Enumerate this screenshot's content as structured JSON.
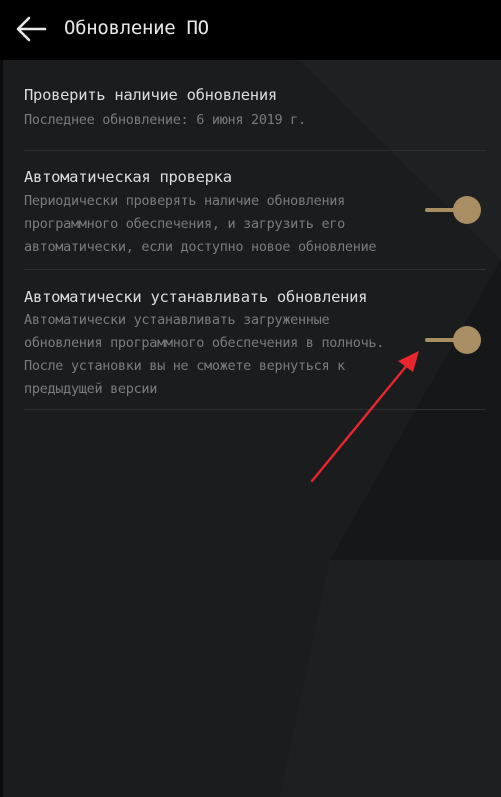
{
  "appbar": {
    "title": "Обновление ПО"
  },
  "settings": [
    {
      "title": "Проверить наличие обновления",
      "subtitle_lines": [
        "Последнее обновление: 6 июня 2019 г."
      ]
    },
    {
      "title": "Автоматическая проверка",
      "subtitle_lines": [
        "Периодически проверять наличие обновления",
        "программного обеспечения, и загрузить его",
        "автоматически, если доступно новое обновление"
      ],
      "toggle_on": true
    },
    {
      "title": "Автоматически устанавливать обновления",
      "subtitle_lines": [
        "Автоматически устанавливать загруженные",
        "обновления программного обеспечения в полночь.",
        "После установки вы не сможете вернуться к",
        "предыдущей версии"
      ],
      "toggle_on": true
    }
  ],
  "colors": {
    "accent": "#a88e62",
    "annotation_arrow": "#e8262d",
    "appbar_bg": "#000000",
    "page_bg": "#1b1c1e"
  },
  "icons": {
    "back": "arrow-left-icon"
  }
}
